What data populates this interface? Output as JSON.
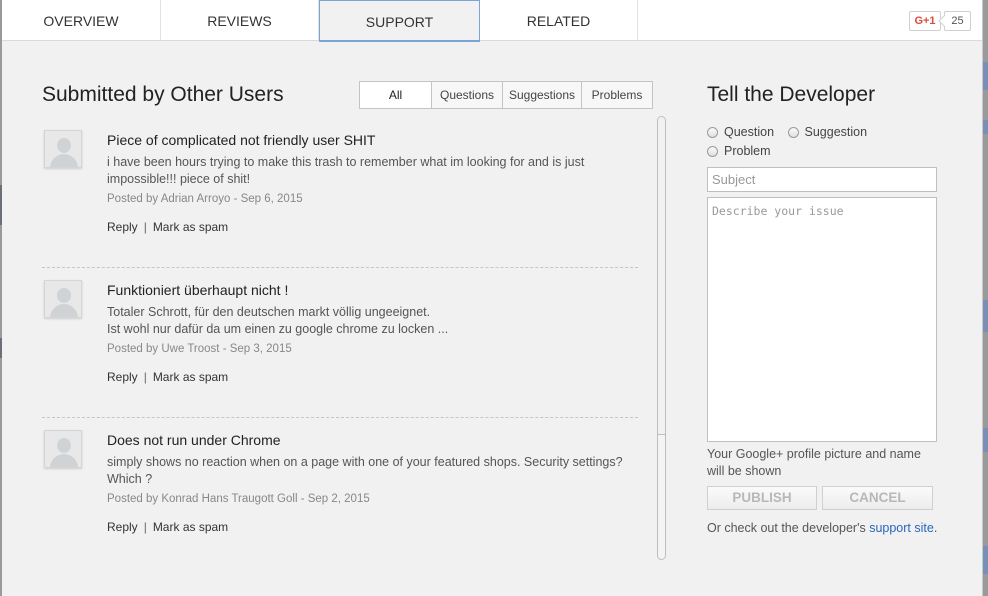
{
  "tabs": [
    {
      "label": "OVERVIEW"
    },
    {
      "label": "REVIEWS"
    },
    {
      "label": "SUPPORT"
    },
    {
      "label": "RELATED"
    }
  ],
  "active_tab": "SUPPORT",
  "gplus": {
    "label": "G+1",
    "count": "25",
    "icon": "google-plus-icon"
  },
  "left": {
    "title": "Submitted by Other Users",
    "filters": [
      {
        "label": "All"
      },
      {
        "label": "Questions"
      },
      {
        "label": "Suggestions"
      },
      {
        "label": "Problems"
      }
    ],
    "active_filter": "All",
    "reviews": [
      {
        "title": "Piece of complicated not friendly user SHIT",
        "body": "i have been hours trying to make this trash to remember what im looking for and is just impossible!!! piece of shit!",
        "meta": "Posted by Adrian Arroyo - Sep 6, 2015",
        "reply": "Reply",
        "sep": "|",
        "spam": "Mark as spam"
      },
      {
        "title": "Funktioniert überhaupt nicht !",
        "body": "Totaler Schrott, für den deutschen markt völlig ungeeignet.\nIst wohl nur dafür da um einen zu google chrome zu locken ...",
        "meta": "Posted by Uwe Troost - Sep 3, 2015",
        "reply": "Reply",
        "sep": "|",
        "spam": "Mark as spam"
      },
      {
        "title": "Does not run under Chrome",
        "body": "simply shows no reaction when on a page with one of your featured shops. Security settings? Which ?",
        "meta": "Posted by Konrad Hans Traugott Goll - Sep 2, 2015",
        "reply": "Reply",
        "sep": "|",
        "spam": "Mark as spam"
      }
    ]
  },
  "right": {
    "title": "Tell the Developer",
    "radios": [
      {
        "label": "Question"
      },
      {
        "label": "Suggestion"
      },
      {
        "label": "Problem"
      }
    ],
    "subject_placeholder": "Subject",
    "describe_placeholder": "Describe your issue",
    "notice": "Your Google+ profile picture and name will be shown",
    "publish_label": "PUBLISH",
    "cancel_label": "CANCEL",
    "checkout_text": "Or check out the developer's ",
    "support_link": "support site",
    "checkout_end": "."
  },
  "colors": {
    "accent": "#7aa4d8",
    "link": "#2a66c0",
    "gplus_red": "#dd4b39"
  }
}
